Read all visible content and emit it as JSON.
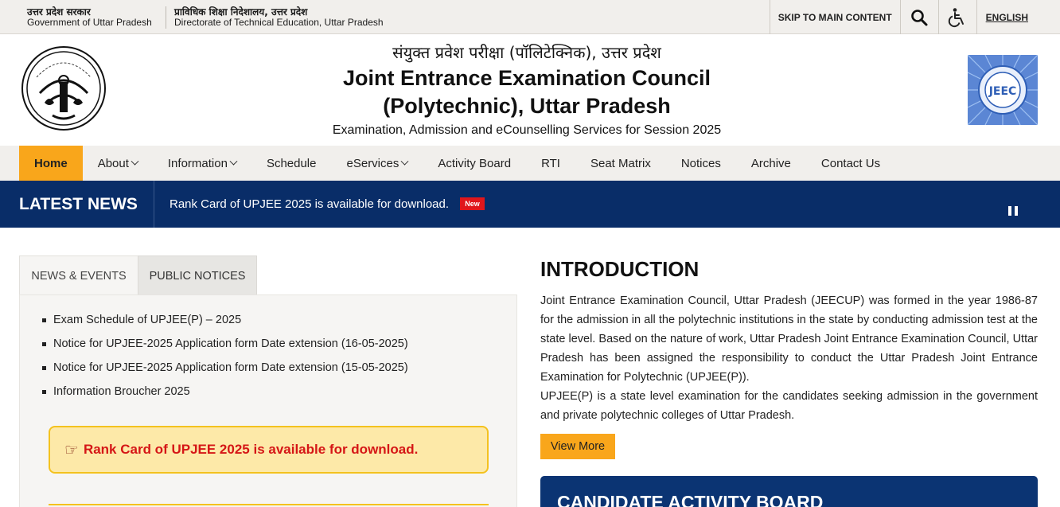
{
  "topbar": {
    "gov_hi": "उत्तर प्रदेश सरकार",
    "gov_en": "Government of Uttar Pradesh",
    "dept_hi": "प्राविधिक शिक्षा निदेशालय, उत्तर प्रदेश",
    "dept_en": "Directorate of Technical Education, Uttar Pradesh",
    "skip": "SKIP TO MAIN CONTENT",
    "search_icon": "search-icon",
    "accessibility_icon": "wheelchair-icon",
    "language": "ENGLISH"
  },
  "header": {
    "title_hi": "संयुक्त प्रवेश परीक्षा (पॉलिटेक्निक), उत्तर प्रदेश",
    "title_en_line1": "Joint Entrance Examination Council",
    "title_en_line2": "(Polytechnic), Uttar Pradesh",
    "subtitle": "Examination, Admission and eCounselling Services for Session 2025",
    "logo_left_text": "उत्तर प्रदेश सरकार",
    "logo_right_text": "JEEC"
  },
  "nav": {
    "items": [
      {
        "label": "Home",
        "active": true,
        "dropdown": false
      },
      {
        "label": "About",
        "active": false,
        "dropdown": true
      },
      {
        "label": "Information",
        "active": false,
        "dropdown": true
      },
      {
        "label": "Schedule",
        "active": false,
        "dropdown": false
      },
      {
        "label": "eServices",
        "active": false,
        "dropdown": true
      },
      {
        "label": "Activity Board",
        "active": false,
        "dropdown": false
      },
      {
        "label": "RTI",
        "active": false,
        "dropdown": false
      },
      {
        "label": "Seat Matrix",
        "active": false,
        "dropdown": false
      },
      {
        "label": "Notices",
        "active": false,
        "dropdown": false
      },
      {
        "label": "Archive",
        "active": false,
        "dropdown": false
      },
      {
        "label": "Contact Us",
        "active": false,
        "dropdown": false
      }
    ]
  },
  "latest_news": {
    "label": "LATEST NEWS",
    "text": "Rank Card of UPJEE 2025 is available for download.",
    "badge": "New"
  },
  "tabs": [
    "NEWS & EVENTS",
    "PUBLIC NOTICES"
  ],
  "news_items": [
    "Exam Schedule of UPJEE(P) – 2025",
    "Notice for UPJEE-2025 Application form Date extension (16-05-2025)",
    "Notice for UPJEE-2025 Application form Date extension (15-05-2025)",
    "Information Broucher 2025"
  ],
  "alert": {
    "text": "Rank Card of UPJEE 2025 is available for download.",
    "icon": "pointing-hand-icon"
  },
  "intro": {
    "title": "INTRODUCTION",
    "para1": "Joint Entrance Examination Council, Uttar Pradesh (JEECUP) was formed in the year 1986-87 for the admission in all the polytechnic institutions in the state by conducting admission test at the state level. Based on the nature of work, Uttar Pradesh Joint Entrance Examination Council, Uttar Pradesh has been assigned the responsibility to conduct the Uttar Pradesh Joint Entrance Examination for Polytechnic (UPJEE(P)).",
    "para2": "UPJEE(P) is a state level examination for the candidates seeking admission in the government and private polytechnic colleges of Uttar Pradesh.",
    "button": "View More"
  },
  "activity_board": {
    "title": "CANDIDATE ACTIVITY BOARD"
  },
  "colors": {
    "accent": "#f9a61b",
    "navy": "#092d68",
    "alert_bg": "#fde9a8",
    "alert_text": "#d51616"
  }
}
